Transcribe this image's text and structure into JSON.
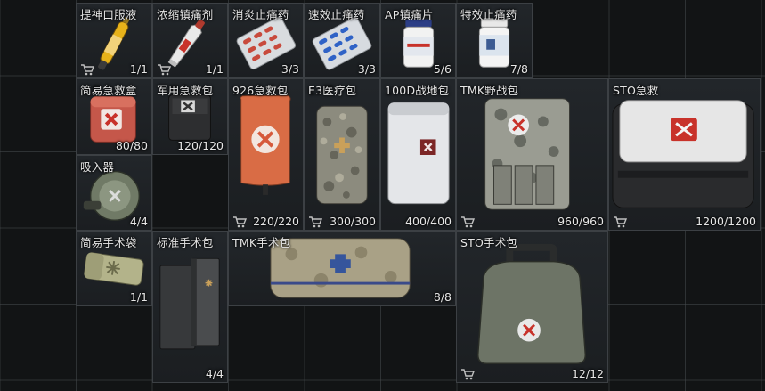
{
  "inventory": {
    "items": [
      {
        "id": "stim-oral",
        "name": "提神口服液",
        "count": "1/1",
        "cart": true
      },
      {
        "id": "analgesic-cream",
        "name": "浓缩镇痛剂",
        "count": "1/1",
        "cart": true
      },
      {
        "id": "anti-inflammatory",
        "name": "消炎止痛药",
        "count": "3/3",
        "cart": false
      },
      {
        "id": "fast-painkiller",
        "name": "速效止痛药",
        "count": "3/3",
        "cart": false
      },
      {
        "id": "ap-painkiller",
        "name": "AP镇痛片",
        "count": "5/6",
        "cart": false
      },
      {
        "id": "special-painkiller",
        "name": "特效止痛药",
        "count": "7/8",
        "cart": false
      },
      {
        "id": "simple-first-aid-box",
        "name": "简易急救盒",
        "count": "80/80",
        "cart": false
      },
      {
        "id": "military-first-aid-kit",
        "name": "军用急救包",
        "count": "120/120",
        "cart": false
      },
      {
        "id": "first-aid-926",
        "name": "926急救包",
        "count": "220/220",
        "cart": true
      },
      {
        "id": "e3-medical-kit",
        "name": "E3医疗包",
        "count": "300/300",
        "cart": true
      },
      {
        "id": "field-kit-100d",
        "name": "100D战地包",
        "count": "400/400",
        "cart": false
      },
      {
        "id": "tmk-field-kit",
        "name": "TMK野战包",
        "count": "960/960",
        "cart": true
      },
      {
        "id": "sto-first-aid",
        "name": "STO急救",
        "count": "1200/1200",
        "cart": true
      },
      {
        "id": "inhaler",
        "name": "吸入器",
        "count": "4/4",
        "cart": false
      },
      {
        "id": "simple-surgical-pouch",
        "name": "简易手术袋",
        "count": "1/1",
        "cart": false
      },
      {
        "id": "standard-surgical-kit",
        "name": "标准手术包",
        "count": "4/4",
        "cart": false
      },
      {
        "id": "tmk-surgical-kit",
        "name": "TMK手术包",
        "count": "8/8",
        "cart": false
      },
      {
        "id": "sto-surgical-kit",
        "name": "STO手术包",
        "count": "12/12",
        "cart": true
      }
    ]
  },
  "colors": {
    "background": "#121415",
    "grid_line": "#3c4044",
    "cell_fill": "#1f2326",
    "text": "#e6e6e6",
    "medical_red": "#c8322a"
  }
}
